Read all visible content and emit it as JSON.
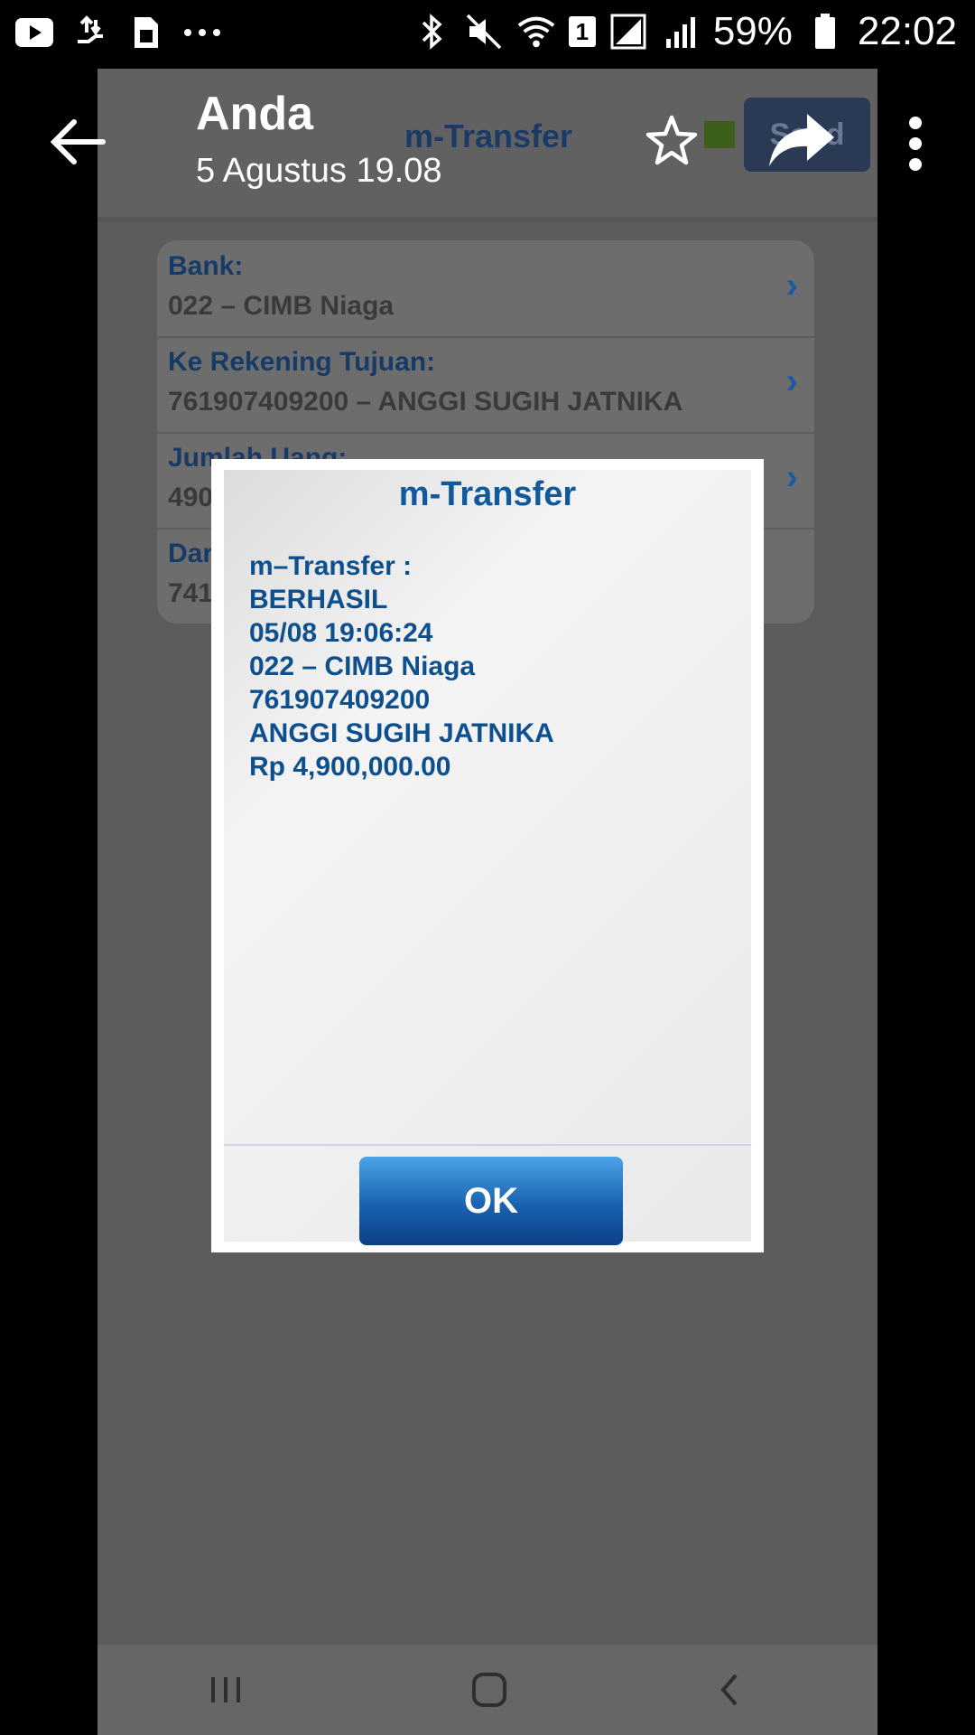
{
  "status_bar": {
    "battery_percent": "59%",
    "time": "22:02",
    "sim_badge": "1",
    "left_icons": [
      "youtube-icon",
      "upload-icon",
      "sim-icon",
      "more-dots-icon"
    ],
    "right_icons": [
      "bluetooth-icon",
      "mute-icon",
      "wifi-icon",
      "signal-icon",
      "battery-icon"
    ]
  },
  "viewer": {
    "sender": "Anda",
    "timestamp": "5 Agustus 19.08"
  },
  "background_app": {
    "title": "m-Transfer",
    "send_label": "Send",
    "rows": [
      {
        "label": "Bank:",
        "value": "022 – CIMB Niaga"
      },
      {
        "label": "Ke Rekening Tujuan:",
        "value": "761907409200 – ANGGI SUGIH JATNIKA"
      },
      {
        "label": "Jumlah Uang:",
        "value": "490"
      },
      {
        "label": "Dari",
        "value": "741"
      }
    ]
  },
  "dialog": {
    "title": "m-Transfer",
    "lines": [
      "m–Transfer :",
      "BERHASIL",
      "05/08 19:06:24",
      "022 – CIMB Niaga",
      "761907409200",
      "ANGGI SUGIH JATNIKA",
      "Rp 4,900,000.00"
    ],
    "ok_label": "OK"
  }
}
